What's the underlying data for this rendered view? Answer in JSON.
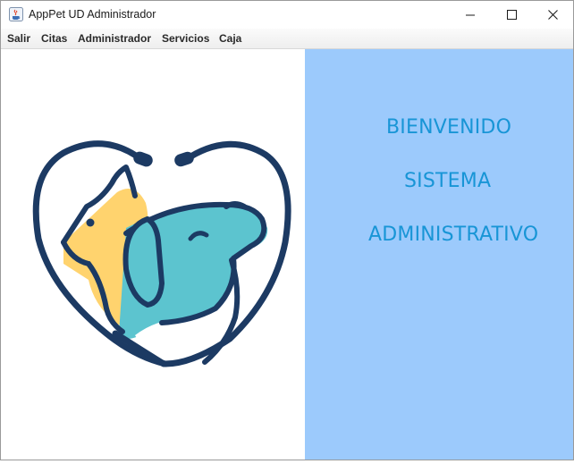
{
  "window": {
    "title": "AppPet UD Administrador",
    "icon": "java-coffee-icon",
    "controls": [
      "minimize-icon",
      "maximize-icon",
      "close-icon"
    ]
  },
  "menubar": {
    "items": [
      {
        "label": "Salir"
      },
      {
        "label": "Citas"
      },
      {
        "label": "Administrador"
      },
      {
        "label": "Servicios"
      },
      {
        "label": "Caja"
      }
    ]
  },
  "content": {
    "logo": "pet-heart-logo",
    "welcome": {
      "line1": "BIENVENIDO",
      "line2": "SISTEMA",
      "line3": "ADMINISTRATIVO"
    }
  },
  "colors": {
    "panel_blue": "#9ccafc",
    "text_blue": "#1895d6",
    "logo_navy": "#1c3a63",
    "logo_yellow": "#ffd36e",
    "logo_teal": "#5cc4cf"
  }
}
